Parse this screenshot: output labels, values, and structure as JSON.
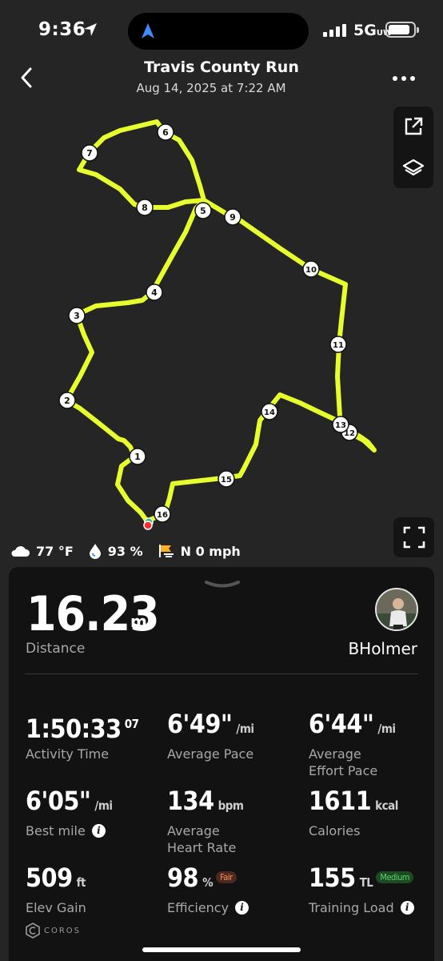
{
  "status_bar": {
    "time": "9:36",
    "network": "5G",
    "network_sup": "UW"
  },
  "header": {
    "title": "Travis County Run",
    "subtitle": "Aug 14, 2025 at 7:22 AM"
  },
  "map": {
    "route_color": "#e8ff2e",
    "markers": [
      "1",
      "2",
      "3",
      "4",
      "5",
      "6",
      "7",
      "8",
      "9",
      "10",
      "11",
      "12",
      "13",
      "14",
      "15",
      "16"
    ],
    "weather": {
      "temperature": "77 °F",
      "humidity": "93 %",
      "wind": "N 0 mph"
    }
  },
  "summary": {
    "distance_value": "16.23",
    "distance_unit": "mi",
    "distance_label": "Distance",
    "username": "BHolmer"
  },
  "metrics": {
    "activity_time": {
      "value": "1:50:33",
      "sup": "07",
      "label": "Activity Time"
    },
    "average_pace": {
      "value": "6'49\"",
      "unit": "/mi",
      "label": "Average Pace"
    },
    "effort_pace": {
      "value": "6'44\"",
      "unit": "/mi",
      "label_line1": "Average",
      "label_line2": "Effort Pace"
    },
    "best_mile": {
      "value": "6'05\"",
      "unit": "/mi",
      "label": "Best mile"
    },
    "heart_rate": {
      "value": "134",
      "unit": "bpm",
      "label_line1": "Average",
      "label_line2": "Heart Rate"
    },
    "calories": {
      "value": "1611",
      "unit": "kcal",
      "label": "Calories"
    },
    "elev_gain": {
      "value": "509",
      "unit": "ft",
      "label": "Elev Gain"
    },
    "efficiency": {
      "value": "98",
      "unit": "%",
      "badge": "Fair",
      "label": "Efficiency"
    },
    "training_load": {
      "value": "155",
      "unit": "TL",
      "badge": "Medium",
      "label": "Training Load"
    }
  },
  "brand": {
    "name": "COROS"
  }
}
